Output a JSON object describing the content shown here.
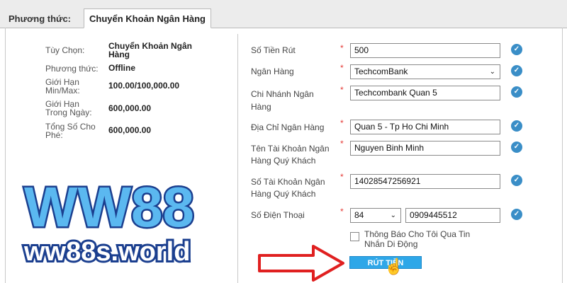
{
  "header": {
    "method_label": "Phương thức:",
    "tab_label": "Chuyển Khoản Ngân Hàng"
  },
  "info": {
    "option_label": "Tùy Chọn:",
    "option_value_line1": "Chuyển Khoản Ngân",
    "option_value_line2": "Hàng",
    "method_label": "Phương thức:",
    "method_value": "Offline",
    "limit_label_line1": "Giới Hạn",
    "limit_label_line2": "Min/Max:",
    "limit_value": "100.00/100,000.00",
    "daily_label_line1": "Giới Hạn",
    "daily_label_line2": "Trong Ngày:",
    "daily_value": "600,000.00",
    "fee_label_line1": "Tổng Số Cho",
    "fee_label_line2": "Phé:",
    "fee_value": "600,000.00"
  },
  "form": {
    "required_mark": "*",
    "valid_icon": "check-circle-icon",
    "amount": {
      "label": "Số Tiền Rút",
      "value": "500"
    },
    "bank": {
      "label": "Ngân Hàng",
      "value": "TechcomBank",
      "arrow": "⌄"
    },
    "branch": {
      "label_line1": "Chi Nhánh Ngân",
      "label_line2": "Hàng",
      "value": "Techcombank Quan 5"
    },
    "address": {
      "label": "Địa Chỉ Ngân Hàng",
      "value": "Quan 5 - Tp Ho Chi Minh"
    },
    "account_name": {
      "label_line1": "Tên Tài Khoản Ngân",
      "label_line2": "Hàng Quý Khách",
      "value": "Nguyen Binh Minh"
    },
    "account_number": {
      "label_line1": "Số Tài Khoản Ngân",
      "label_line2": "Hàng Quý Khách",
      "value": "14028547256921"
    },
    "phone": {
      "label": "Số Điện Thoại",
      "code": "84",
      "code_arrow": "⌄",
      "value": "0909445512"
    },
    "notify": {
      "checked": false,
      "label_line1": "Thông Báo Cho Tôi Qua Tin",
      "label_line2": "Nhắn Di Động"
    },
    "submit_label": "RÚT TIỀN"
  },
  "overlay": {
    "logo_text": "WW88",
    "site_text": "ww88s.world"
  },
  "colors": {
    "accent": "#2ea7e8",
    "required": "#e53935",
    "check": "#3a8ec7",
    "arrow": "#e02020",
    "logo_fill": "#5bb8f0",
    "logo_stroke": "#1b3f8f"
  }
}
